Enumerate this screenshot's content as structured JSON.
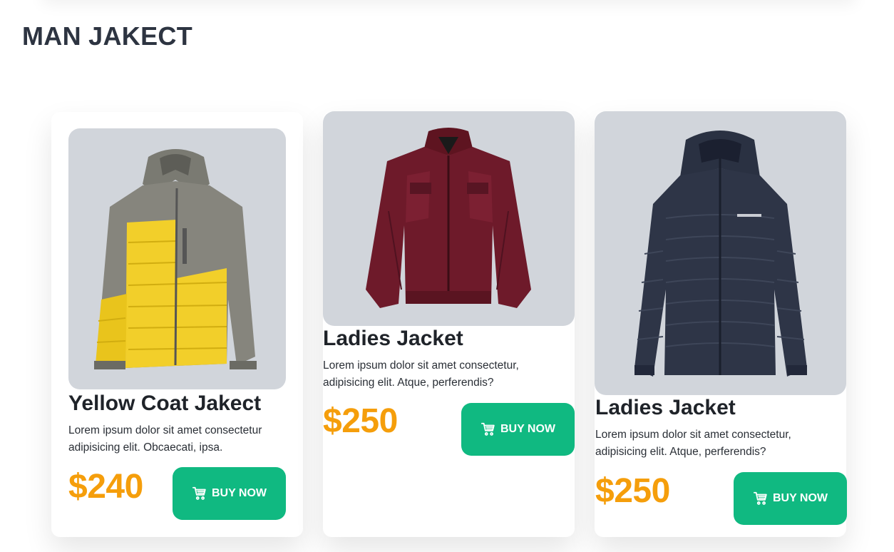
{
  "page": {
    "title": "MAN JAKECT"
  },
  "colors": {
    "price": "#f59e0b",
    "button": "#10b981",
    "image_bg": "#d1d5db",
    "title": "#2d3441"
  },
  "products": [
    {
      "title": "Yellow Coat Jakect",
      "description": "Lorem ipsum dolor sit amet consectetur adipisicing elit. Obcaecati, ipsa.",
      "price": "$240",
      "button_label": "BUY NOW",
      "button_icon": "cart-icon",
      "image": "yellow-gray-puffer-jacket"
    },
    {
      "title": "Ladies Jacket",
      "description": "Lorem ipsum dolor sit amet consectetur, adipisicing elit. Atque, perferendis?",
      "price": "$250",
      "button_label": "BUY NOW",
      "button_icon": "cart-icon",
      "image": "burgundy-leather-jacket"
    },
    {
      "title": "Ladies Jacket",
      "description": "Lorem ipsum dolor sit amet consectetur, adipisicing elit. Atque, perferendis?",
      "price": "$250",
      "button_label": "BUY NOW",
      "button_icon": "cart-icon",
      "image": "navy-puffer-jacket"
    }
  ]
}
